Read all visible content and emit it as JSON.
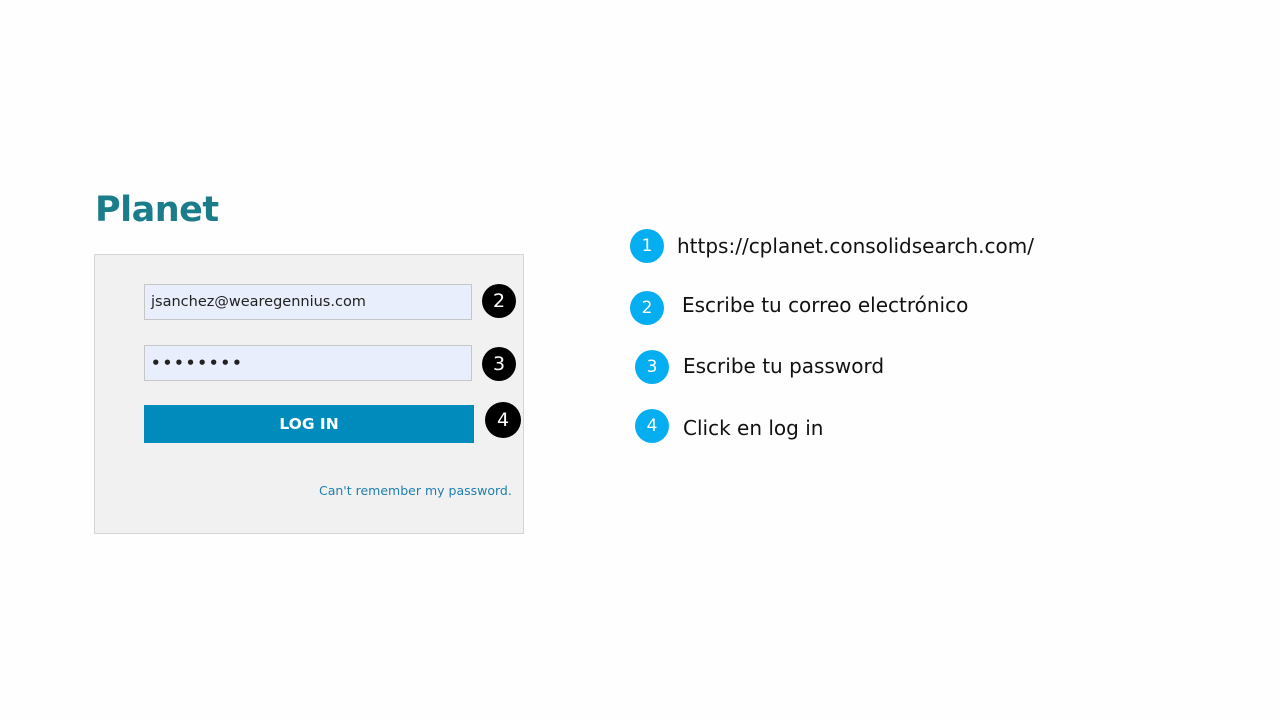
{
  "login_panel": {
    "logo_text": "Planet",
    "email_value": "jsanchez@wearegennius.com",
    "password_value": "••••••••",
    "login_button_label": "LOG IN",
    "forgot_password_link": "Can't remember my password."
  },
  "callouts": [
    {
      "number": "2"
    },
    {
      "number": "3"
    },
    {
      "number": "4"
    }
  ],
  "steps": [
    {
      "number": "1",
      "text": "https://cplanet.consolidsearch.com/"
    },
    {
      "number": "2",
      "text": "Escribe tu correo electrónico"
    },
    {
      "number": "3",
      "text": "Escribe tu password"
    },
    {
      "number": "4",
      "text": "Click en log in"
    }
  ],
  "colors": {
    "logo": "#1b7c8a",
    "button": "#008bbd",
    "step_circle": "#05aef0",
    "callout_badge": "#000000",
    "field_background": "#e8eefc"
  }
}
